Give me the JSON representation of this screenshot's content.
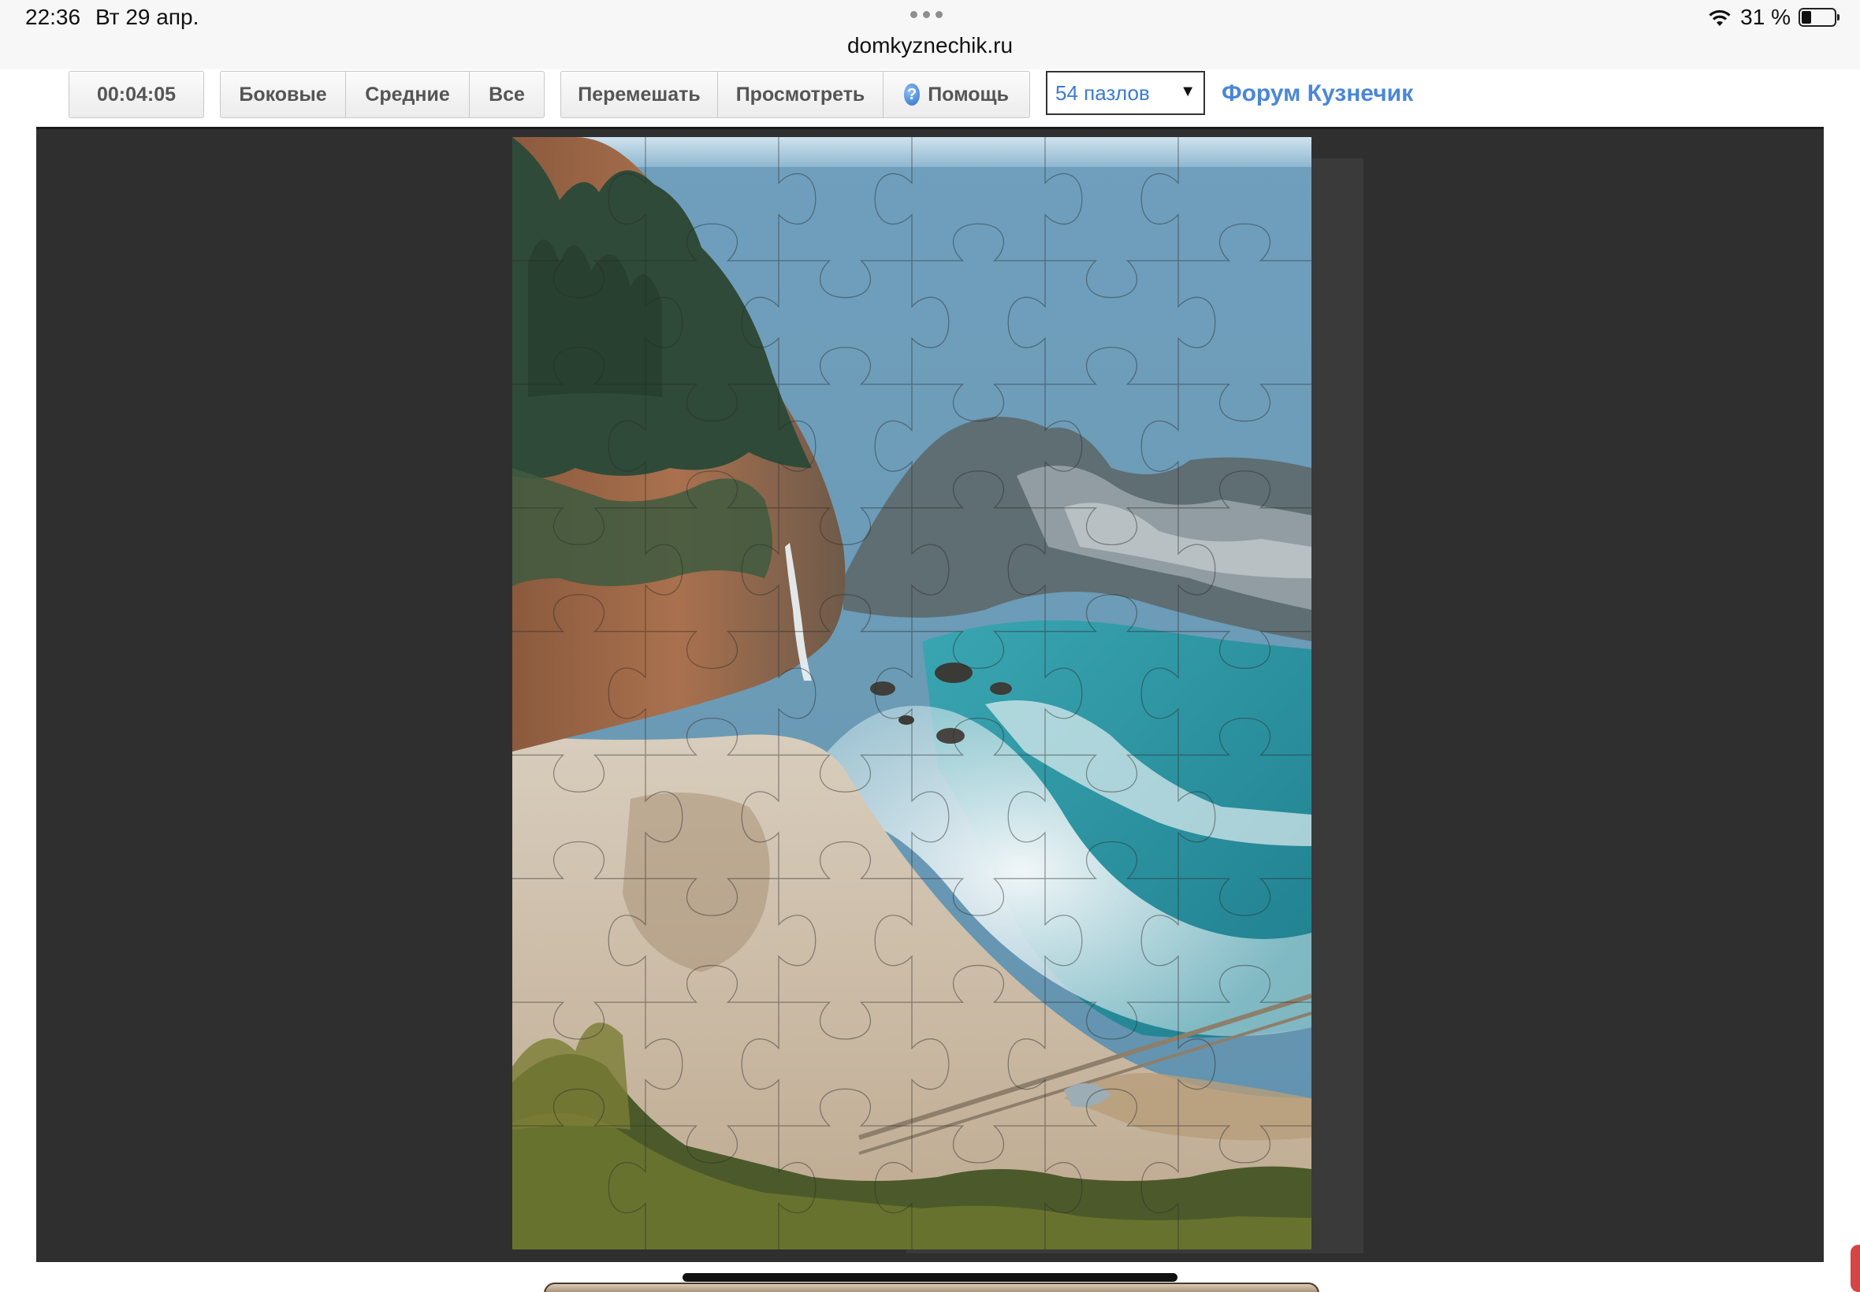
{
  "status_bar": {
    "time": "22:36",
    "date": "Вт 29 апр.",
    "url": "domkyznechik.ru",
    "battery_percent": "31 %",
    "battery_level": 0.31,
    "icons": [
      "wifi-icon",
      "battery-icon"
    ]
  },
  "toolbar": {
    "timer": "00:04:05",
    "filter_buttons": [
      "Боковые",
      "Средние",
      "Все"
    ],
    "shuffle_label": "Перемешать",
    "preview_label": "Просмотреть",
    "help_label": "Помощь",
    "help_icon_glyph": "?",
    "pieces_select": "54 пазлов",
    "forum_link": "Форум Кузнечик"
  },
  "puzzle": {
    "columns": 6,
    "rows": 9,
    "piece_count": 54,
    "image": "coastal cove with waterfall, beach and turquoise sea"
  },
  "colors": {
    "board_background": "#2f2f2f",
    "link": "#4a86d8",
    "select_text": "#3b7bd6"
  }
}
